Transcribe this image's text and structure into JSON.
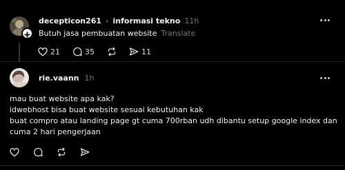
{
  "post": {
    "username": "decepticon261",
    "separator_icon": "chevron-right-icon",
    "topic": "informasi tekno",
    "time": "11h",
    "text": "Butuh jasa pembuatan website",
    "translate_label": "Translate",
    "likes": "21",
    "comments": "35",
    "shares": "11"
  },
  "reply": {
    "username": "rie.vaann",
    "time": "1h",
    "lines": [
      "mau buat website apa kak?",
      "idwebhost bisa buat website sesuai kebutuhan kak",
      "buat compro atau landing page gt cuma 700rban udh dibantu setup google index dan",
      "cuma 2 hari pengerjaan"
    ]
  },
  "colors": {
    "background": "#000000",
    "text": "#f3f5f7",
    "muted": "#777777",
    "thread_line": "#333638"
  },
  "icons": {
    "like": "heart-icon",
    "comment": "comment-bubble-icon",
    "repost": "repost-icon",
    "share": "send-icon",
    "more": "more-dots-icon",
    "follow": "plus-icon"
  }
}
